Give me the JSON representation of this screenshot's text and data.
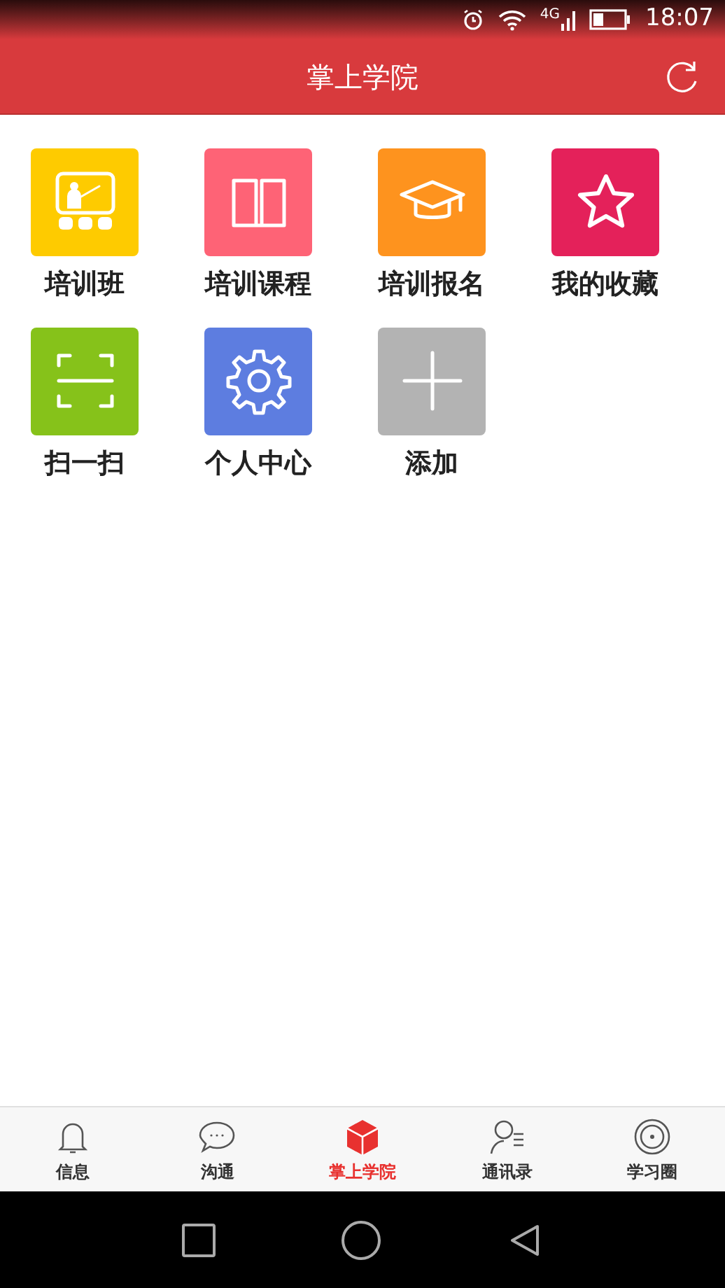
{
  "status_bar": {
    "network": "4G",
    "time": "18:07"
  },
  "header": {
    "title": "掌上学院"
  },
  "tiles": [
    {
      "label": "培训班",
      "color": "#fecb00"
    },
    {
      "label": "培训课程",
      "color": "#fe6376"
    },
    {
      "label": "培训报名",
      "color": "#fe931e"
    },
    {
      "label": "我的收藏",
      "color": "#e4215a"
    },
    {
      "label": "扫一扫",
      "color": "#86c21a"
    },
    {
      "label": "个人中心",
      "color": "#5d7de0"
    },
    {
      "label": "添加",
      "color": "#b3b3b3"
    }
  ],
  "tab_bar": [
    {
      "label": "信息",
      "selected": false
    },
    {
      "label": "沟通",
      "selected": false
    },
    {
      "label": "掌上学院",
      "selected": true
    },
    {
      "label": "通讯录",
      "selected": false
    },
    {
      "label": "学习圈",
      "selected": false
    }
  ]
}
